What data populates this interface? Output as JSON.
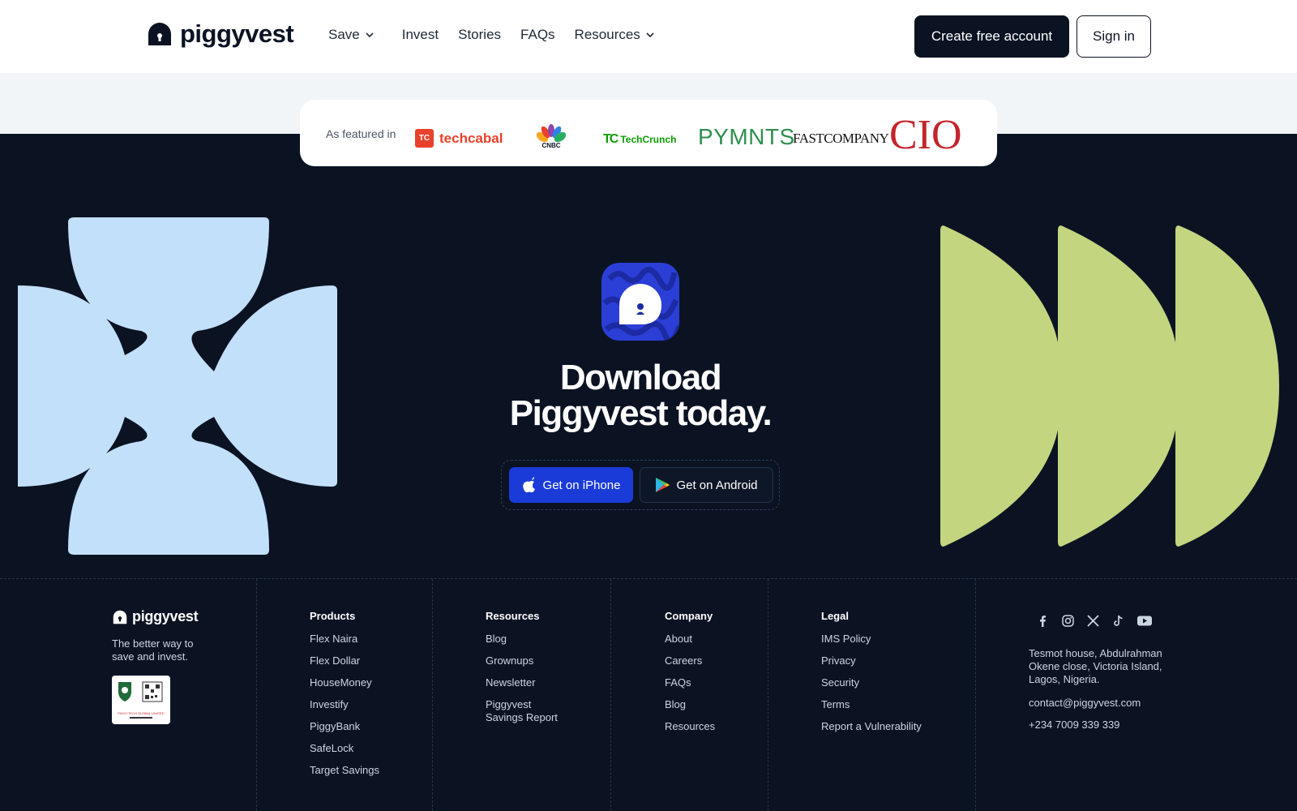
{
  "brand": {
    "name": "piggyvest",
    "accent": "#1b3bd8",
    "dark": "#0b1323",
    "lime": "#c3d67f",
    "sky": "#c3e0fb"
  },
  "nav": {
    "items": [
      {
        "label": "Save",
        "dropdown": true
      },
      {
        "label": "Invest",
        "dropdown": false
      },
      {
        "label": "Stories",
        "dropdown": false
      },
      {
        "label": "FAQs",
        "dropdown": false
      },
      {
        "label": "Resources",
        "dropdown": true
      }
    ],
    "create_account": "Create free account",
    "sign_in": "Sign in"
  },
  "featured": {
    "label": "As featured in",
    "outlets": [
      {
        "name": "techcabal",
        "mark": "TC"
      },
      {
        "name": "CNBC"
      },
      {
        "name": "TechCrunch",
        "mark": "TC"
      },
      {
        "name": "PYMNTS"
      },
      {
        "name": "FAST COMPANY",
        "display": "FASTCOMPANY"
      },
      {
        "name": "CIO"
      }
    ]
  },
  "download": {
    "title_line1": "Download",
    "title_line2": "Piggyvest today.",
    "ios_label": "Get on iPhone",
    "android_label": "Get on Android"
  },
  "footer": {
    "logo": "piggyvest",
    "tagline": "The better way to save and invest.",
    "badge_text": "PIGGYTECH GLOBAL LIMITED",
    "columns": [
      {
        "heading": "Products",
        "links": [
          "Flex Naira",
          "Flex Dollar",
          "HouseMoney",
          "Investify",
          "PiggyBank",
          "SafeLock",
          "Target Savings"
        ]
      },
      {
        "heading": "Resources",
        "links": [
          "Blog",
          "Grownups",
          "Newsletter",
          "Piggyvest Savings Report"
        ]
      },
      {
        "heading": "Company",
        "links": [
          "About",
          "Careers",
          "FAQs",
          "Blog",
          "Resources"
        ]
      },
      {
        "heading": "Legal",
        "links": [
          "IMS Policy",
          "Privacy",
          "Security",
          "Terms",
          "Report a Vulnerability"
        ]
      }
    ],
    "socials": [
      "facebook-icon",
      "instagram-icon",
      "x-icon",
      "tiktok-icon",
      "youtube-icon"
    ],
    "address": "Tesmot house, Abdulrahman Okene close, Victoria Island, Lagos, Nigeria.",
    "email": "contact@piggyvest.com",
    "phone": "+234 7009 339 339"
  }
}
